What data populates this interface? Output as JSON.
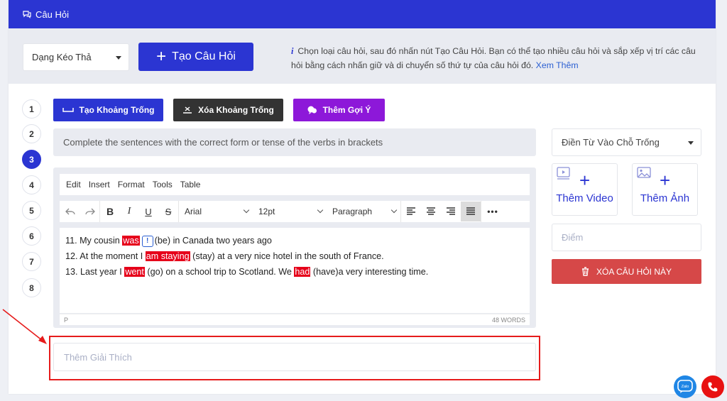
{
  "header": {
    "title": "Câu Hỏi",
    "icon": "chat-icon"
  },
  "controls": {
    "type_select": "Dạng Kéo Thả",
    "create_button": "Tạo Câu Hỏi",
    "hint_text": "Chọn loại câu hỏi, sau đó nhấn nút Tạo Câu Hỏi. Bạn có thể tạo nhiều câu hỏi và sắp xếp vị trí các câu hỏi bằng cách nhấn giữ và di chuyển số thứ tự của câu hỏi đó.",
    "hint_more": "Xem Thêm",
    "hint_icon": "i"
  },
  "question_numbers": [
    "1",
    "2",
    "3",
    "4",
    "5",
    "6",
    "7",
    "8"
  ],
  "active_question": "3",
  "tools": {
    "create_blank": "Tạo Khoảng Trống",
    "erase_blank": "Xóa Khoảng Trống",
    "add_hint": "Thêm Gợi Ý"
  },
  "prompt": "Complete the sentences with the correct form or tense of the verbs in brackets",
  "editor": {
    "menu": [
      "Edit",
      "Insert",
      "Format",
      "Tools",
      "Table"
    ],
    "font": "Arial",
    "size": "12pt",
    "block": "Paragraph",
    "lines": [
      {
        "pre": "11. My cousin ",
        "blank": "was",
        "hint": "!",
        "post": "(be) in Canada two years ago"
      },
      {
        "pre": "12. At the moment I ",
        "blank": "am staying",
        "post": " (stay) at a very nice hotel in the south of France."
      },
      {
        "pre": "13. Last year I ",
        "blank": "went",
        "mid": " (go) on a school trip to Scotland. We ",
        "blank2": "had",
        "post": " (have)a very interesting time."
      }
    ],
    "status_path": "P",
    "word_count": "48 WORDS"
  },
  "explain_placeholder": "Thêm Giải Thích",
  "right_panel": {
    "type_select": "Điền Từ Vào Chỗ Trống",
    "add_video": "Thêm Video",
    "add_image": "Thêm Ảnh",
    "score_placeholder": "Điểm",
    "delete_button": "XÓA CÂU HỎI NÀY"
  },
  "floating": {
    "zalo_label": "Zalo"
  },
  "colors": {
    "primary": "#2b35d2",
    "dark": "#333333",
    "purple": "#8d18d9",
    "danger": "#d64848",
    "blank": "#e6001a",
    "annotation": "#e61c1c"
  }
}
